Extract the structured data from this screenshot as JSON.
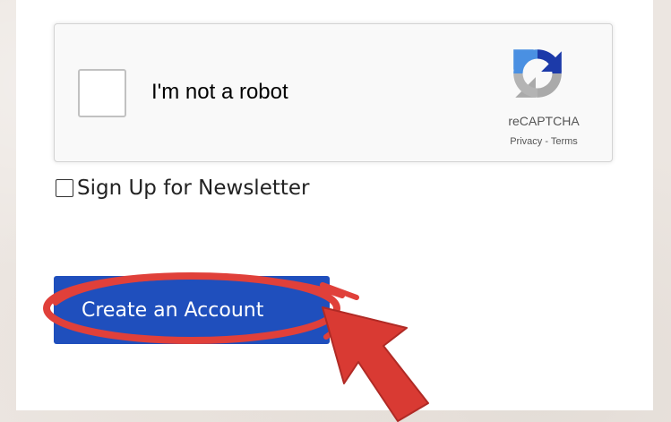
{
  "recaptcha": {
    "checkbox_label": "I'm not a robot",
    "brand": "reCAPTCHA",
    "privacy_link": "Privacy",
    "separator": " - ",
    "terms_link": "Terms",
    "checked": false
  },
  "newsletter": {
    "label": "Sign Up for Newsletter",
    "checked": false
  },
  "create_account": {
    "label": "Create an Account"
  },
  "colors": {
    "button_blue": "#1f4fbd",
    "annotation_red": "#e0403a",
    "recaptcha_blue": "#1c3aa9",
    "recaptcha_light_blue": "#4a90e2",
    "recaptcha_gray": "#aaaaaa"
  },
  "icons": {
    "recaptcha_logo": "recaptcha-logo-icon",
    "annotation_arrow": "arrow-pointer-icon"
  }
}
